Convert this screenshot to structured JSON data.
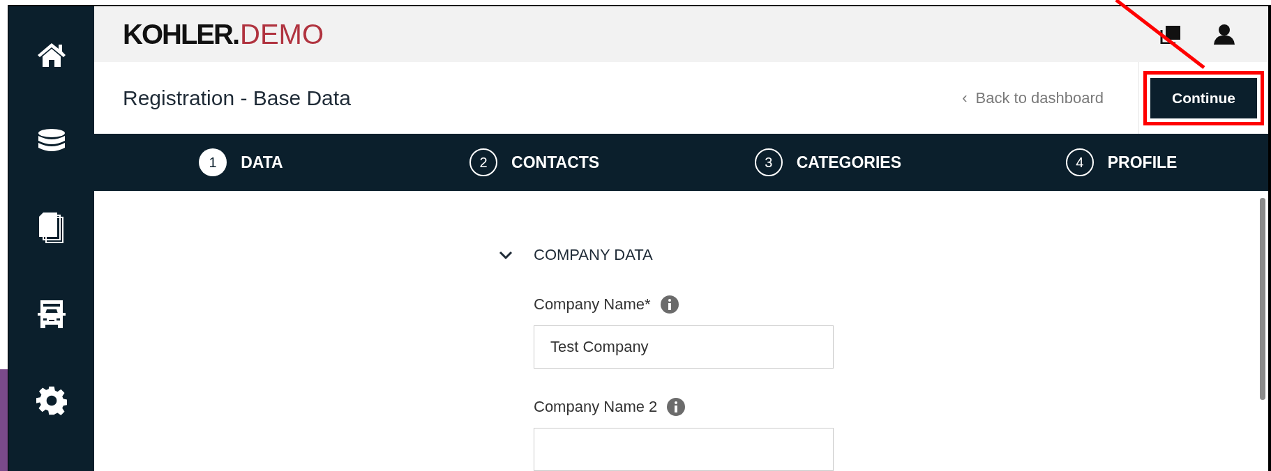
{
  "logo": {
    "brand": "KOHLER",
    "dot": ".",
    "suffix": "DEMO"
  },
  "sidebar": {
    "items": [
      {
        "kind": "home"
      },
      {
        "kind": "database"
      },
      {
        "kind": "documents"
      },
      {
        "kind": "truck"
      },
      {
        "kind": "settings"
      }
    ]
  },
  "page_title": "Registration - Base Data",
  "back_link": {
    "icon": "‹",
    "label": "Back to dashboard"
  },
  "continue_button": "Continue",
  "steps": [
    {
      "number": "1",
      "label": "DATA",
      "selected": true
    },
    {
      "number": "2",
      "label": "CONTACTS",
      "selected": false
    },
    {
      "number": "3",
      "label": "CATEGORIES",
      "selected": false
    },
    {
      "number": "4",
      "label": "PROFILE",
      "selected": false
    }
  ],
  "section": {
    "title": "COMPANY DATA",
    "expanded": true,
    "fields": [
      {
        "label": "Company Name*",
        "value": "Test Company"
      },
      {
        "label": "Company Name 2"
      }
    ]
  }
}
